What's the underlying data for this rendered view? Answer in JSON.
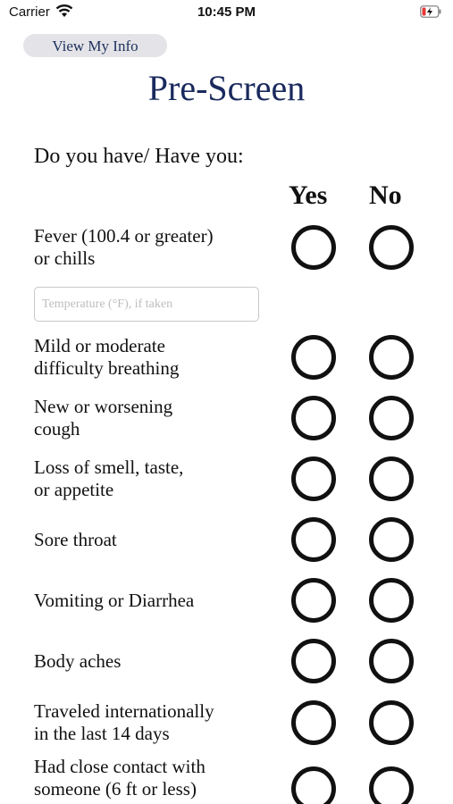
{
  "status": {
    "carrier": "Carrier",
    "time": "10:45 PM"
  },
  "header": {
    "view_info_label": "View My Info",
    "title": "Pre-Screen"
  },
  "question": "Do you have/ Have you:",
  "columns": {
    "yes": "Yes",
    "no": "No"
  },
  "temperature": {
    "placeholder": "Temperature (°F), if taken",
    "value": ""
  },
  "symptoms": [
    {
      "line1": "Fever (100.4 or greater)",
      "line2": "or chills"
    },
    {
      "line1": "Mild or moderate",
      "line2": "difficulty breathing"
    },
    {
      "line1": "New or worsening",
      "line2": "cough"
    },
    {
      "line1": "Loss of smell, taste,",
      "line2": "or appetite"
    },
    {
      "line1": "Sore throat",
      "line2": ""
    },
    {
      "line1": "Vomiting or Diarrhea",
      "line2": ""
    },
    {
      "line1": "Body aches",
      "line2": ""
    },
    {
      "line1": "Traveled internationally",
      "line2": "in the last 14 days"
    },
    {
      "line1": "Had close contact with",
      "line2": "someone (6 ft or less)"
    }
  ]
}
